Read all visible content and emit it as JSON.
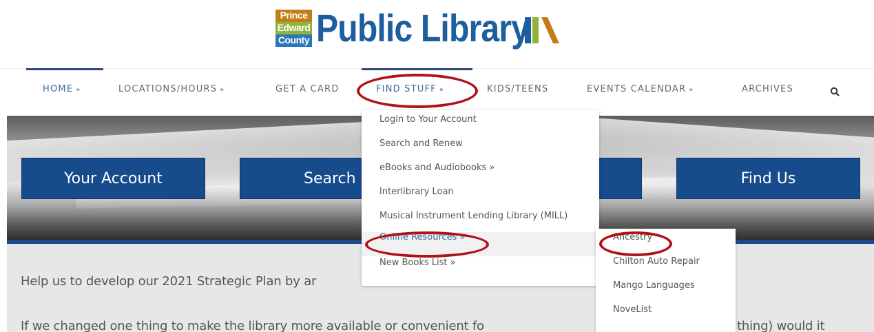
{
  "logo": {
    "block_lines": [
      "Prince",
      "Edward",
      "County"
    ],
    "title": "Public Library"
  },
  "nav": {
    "items": [
      {
        "label": "HOME",
        "chevron": "»"
      },
      {
        "label": "LOCATIONS/HOURS",
        "chevron": "»"
      },
      {
        "label": "GET A CARD",
        "chevron": ""
      },
      {
        "label": "FIND STUFF",
        "chevron": "»"
      },
      {
        "label": "KIDS/TEENS",
        "chevron": ""
      },
      {
        "label": "EVENTS CALENDAR",
        "chevron": "»"
      },
      {
        "label": "ARCHIVES",
        "chevron": ""
      }
    ],
    "search_icon": "search-icon"
  },
  "hero": {
    "buttons": [
      "Your Account",
      "Search",
      "Find Us"
    ]
  },
  "dropdown": {
    "items": [
      "Login to Your Account",
      "Search and Renew",
      "eBooks and Audiobooks »",
      "Interlibrary Loan",
      "Musical Instrument Lending Library (MILL)",
      "Online Resources »",
      "New Books List »"
    ]
  },
  "submenu": {
    "items": [
      "Ancestry",
      "Chilton Auto Repair",
      "Mango Languages",
      "NoveList"
    ]
  },
  "content": {
    "para1": "Help us to develop our 2021 Strategic Plan by ar",
    "para2": "If we changed one thing to make the library more available or convenient fo",
    "para2_tail": "thing) would it"
  },
  "colors": {
    "brand_blue": "#1d5e9e",
    "button_blue": "#164b8c",
    "annotation_red": "#b0121a",
    "active_nav": "#3d6a9c"
  }
}
